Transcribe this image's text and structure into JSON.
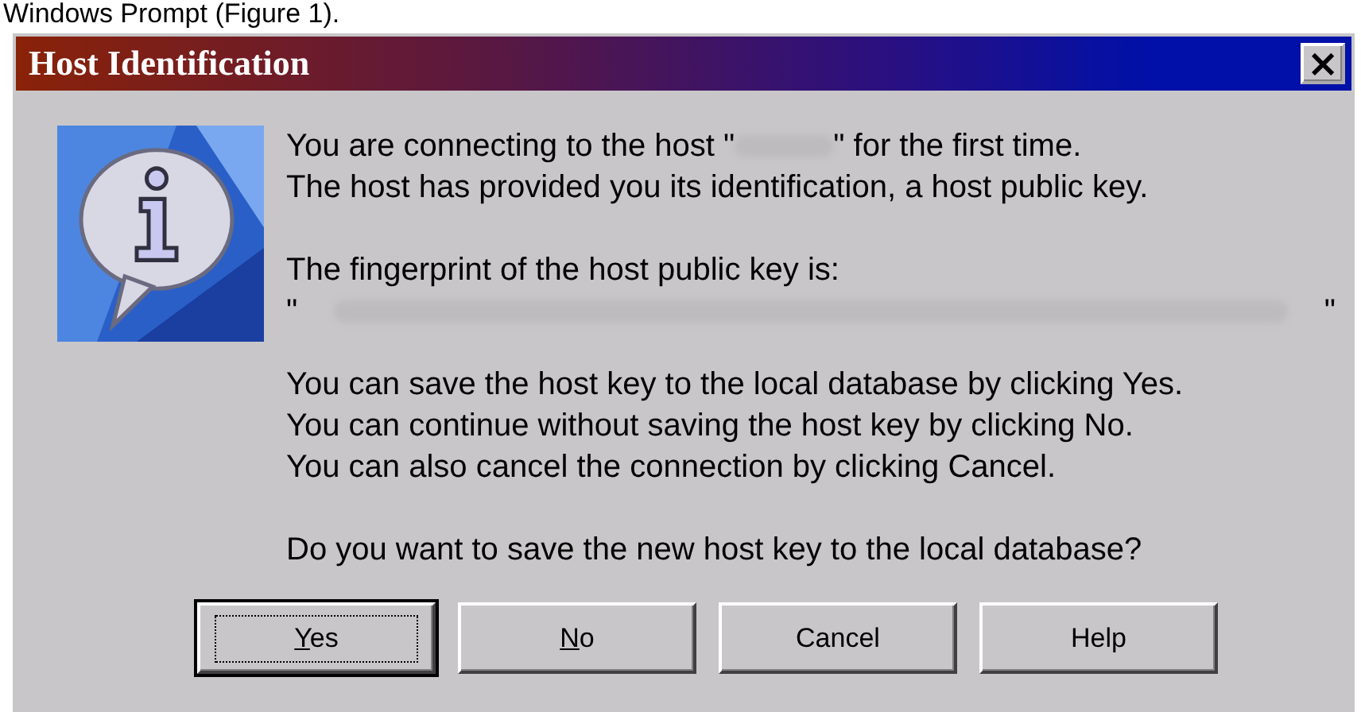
{
  "caption": "Windows Prompt (Figure 1).",
  "window": {
    "title": "Host Identification",
    "close": "×"
  },
  "message": {
    "intro_before": "You are connecting to the host \"",
    "intro_after": "\" for the first time.",
    "line_2": "The host has provided you its identification, a host public key.",
    "fingerprint_label": "The fingerprint of the host public key is:",
    "fingerprint_open": "\"",
    "fingerprint_close": "\"",
    "paragraph": [
      "You can save the host key to the local database by clicking Yes.",
      "You can continue without saving the host key by clicking No.",
      "You can also cancel the connection by clicking Cancel."
    ],
    "question": "Do you want to save the new host key to the local database?"
  },
  "buttons": [
    {
      "label": "Yes",
      "mnemonic_underlined": true,
      "focused": true
    },
    {
      "label": "No",
      "mnemonic_underlined": true,
      "focused": false
    },
    {
      "label": "Cancel",
      "mnemonic_underlined": false,
      "focused": false
    },
    {
      "label": "Help",
      "mnemonic_underlined": false,
      "focused": false
    }
  ]
}
